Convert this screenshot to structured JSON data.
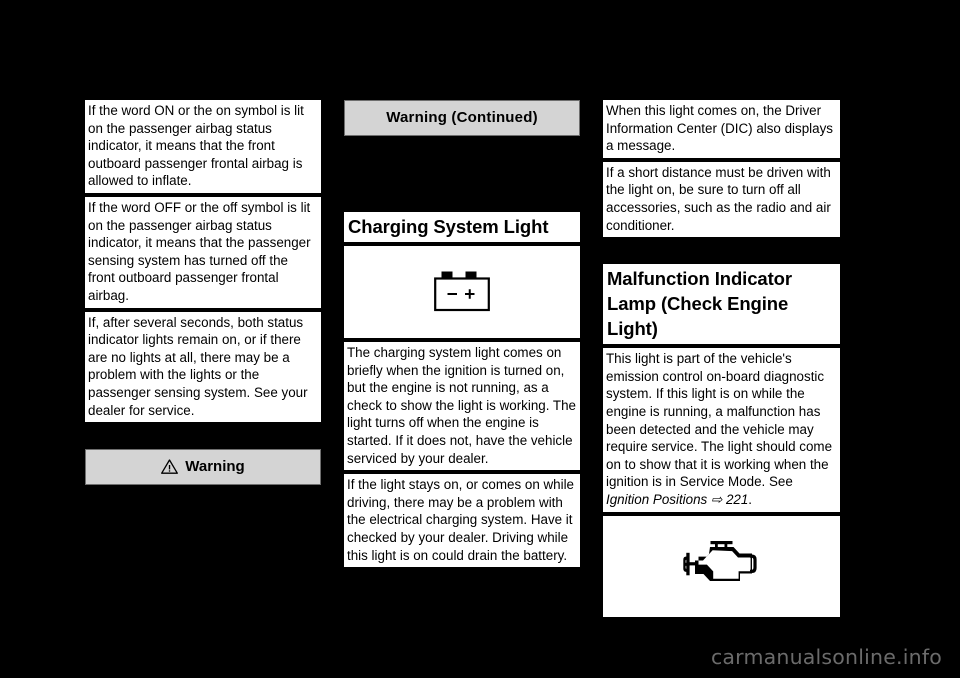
{
  "page": {
    "background_color": "#000000",
    "text_block_color": "#ffffff",
    "warning_bar_color": "#d4d4d4",
    "watermark": "carmanualsonline.info"
  },
  "left_column": {
    "blocks": [
      {
        "id": "airbag-on-symbol",
        "text": "If the word ON or the on symbol is lit on the passenger airbag status indicator, it means that the front outboard passenger frontal airbag is allowed to inflate."
      },
      {
        "id": "airbag-off-symbol",
        "text": "If the word OFF or the off symbol is lit on the passenger airbag status indicator, it means that the passenger sensing system has turned off the front outboard passenger frontal airbag."
      },
      {
        "id": "airbag-both-lights",
        "text": "If, after several seconds, both status indicator lights remain on, or if there are no lights at all, there may be a problem with the lights or the passenger sensing system. See your dealer for service."
      }
    ],
    "warning_bar": {
      "label": "Warning",
      "icon": "warning-triangle-icon"
    }
  },
  "middle_column": {
    "warning_continued_bar": {
      "label": "Warning  (Continued)"
    },
    "heading": "Charging System Light",
    "symbol": {
      "icon": "battery-icon",
      "minus_label": "–",
      "plus_label": "+"
    },
    "blocks": [
      {
        "id": "charging-light-check",
        "text": "The charging system light comes on briefly when the ignition is turned on, but the engine is not running, as a check to show the light is working. The light turns off when the engine is started. If it does not, have the vehicle serviced by your dealer."
      },
      {
        "id": "charging-light-stays-on",
        "text": "If the light stays on, or comes on while driving, there may be a problem with the electrical charging system. Have it checked by your dealer. Driving while this light is on could drain the battery."
      }
    ]
  },
  "right_column": {
    "blocks_top": [
      {
        "id": "dic-message",
        "text": "When this light comes on, the Driver Information Center (DIC) also displays a message."
      },
      {
        "id": "short-distance-accessories",
        "text": "If a short distance must be driven with the light on, be sure to turn off all accessories, such as the radio and air conditioner."
      }
    ],
    "heading": "Malfunction Indicator Lamp (Check Engine Light)",
    "body": {
      "id": "mil-description",
      "text_before_xref": "This light is part of the vehicle's emission control on-board diagnostic system. If this light is on while the engine is running, a malfunction has been detected and the vehicle may require service. The light should come on to show that it is working when the ignition is in Service Mode. See ",
      "xref_title": "Ignition Positions",
      "xref_arrow": "⇨",
      "xref_page": "221",
      "text_after_xref": "."
    },
    "symbol": {
      "icon": "check-engine-icon"
    }
  }
}
